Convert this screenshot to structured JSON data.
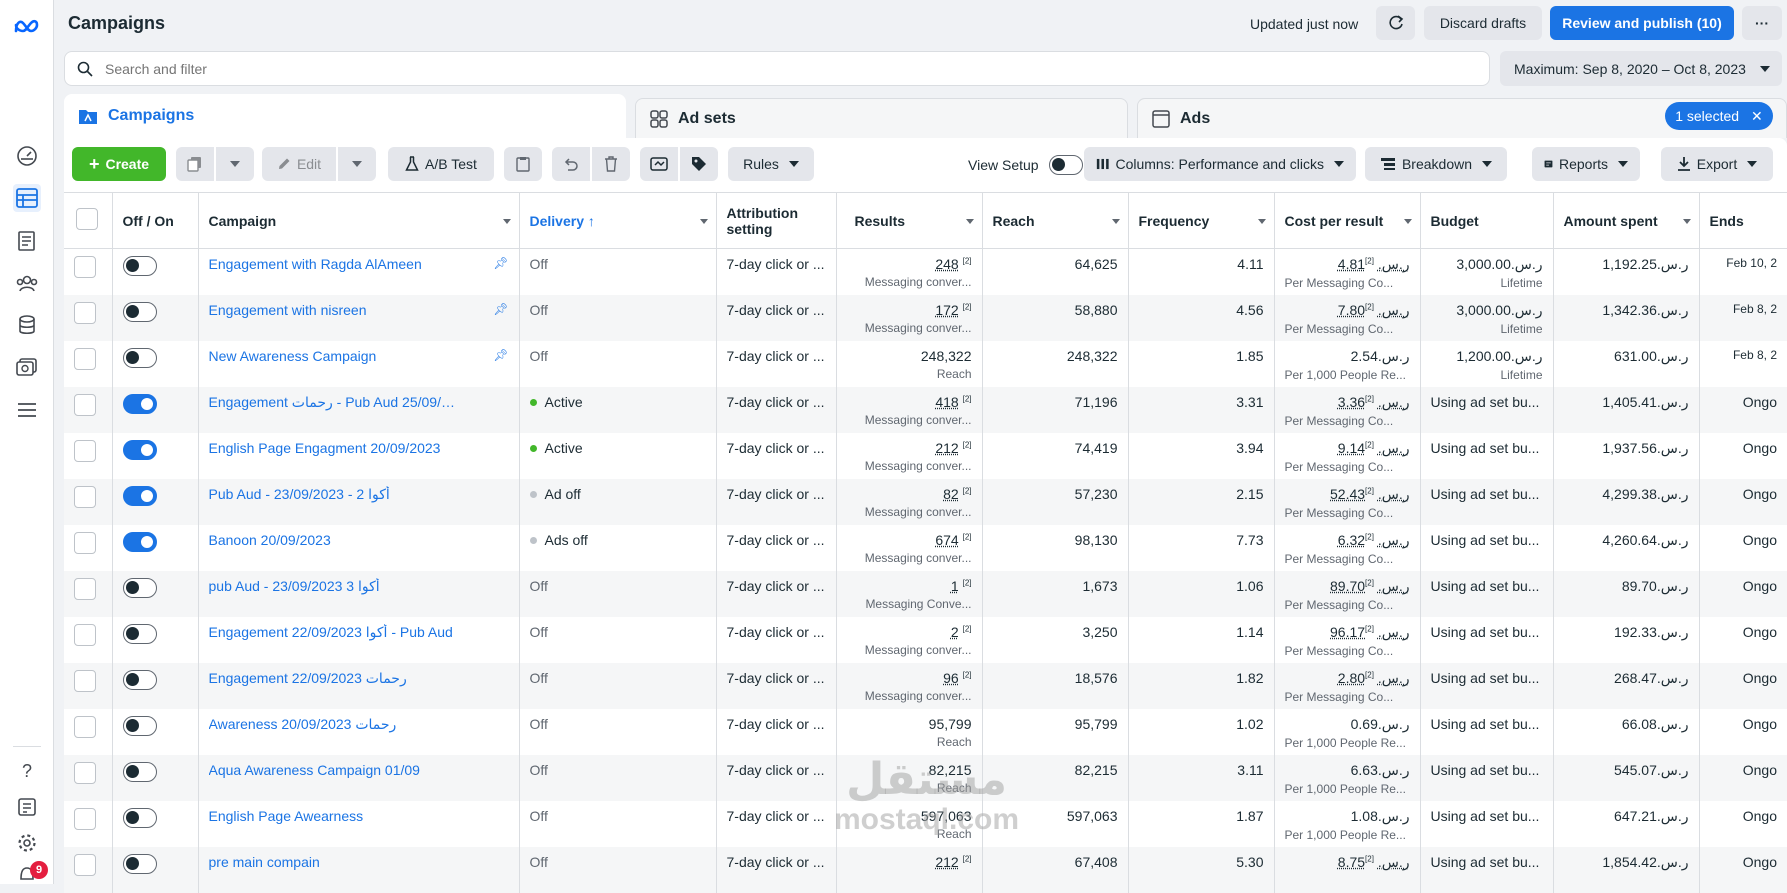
{
  "header": {
    "title": "Campaigns",
    "updated": "Updated just now",
    "discard": "Discard drafts",
    "review": "Review and publish (10)",
    "more": "···"
  },
  "search": {
    "placeholder": "Search and filter"
  },
  "date_range": "Maximum: Sep 8, 2020 – Oct 8, 2023",
  "tabs": [
    {
      "label": "Campaigns"
    },
    {
      "label": "Ad sets"
    },
    {
      "label": "Ads"
    }
  ],
  "selected_chip": "1 selected",
  "toolbar": {
    "create": "Create",
    "edit": "Edit",
    "ab_test": "A/B Test",
    "rules": "Rules",
    "view_setup": "View Setup",
    "columns": "Columns: Performance and clicks",
    "breakdown": "Breakdown",
    "reports": "Reports",
    "export": "Export"
  },
  "columns": [
    "Off / On",
    "Campaign",
    "Delivery ↑",
    "Attribution setting",
    "Results",
    "Reach",
    "Frequency",
    "Cost per result",
    "Budget",
    "Amount spent",
    "Ends"
  ],
  "rows": [
    {
      "on": false,
      "name": "Engagement with Ragda AlAmeen",
      "pinned": true,
      "delivery": "Off",
      "dot": "",
      "attr": "7-day click or ...",
      "results": "248",
      "results_sup": "[2]",
      "results_sub": "Messaging conver...",
      "reach": "64,625",
      "freq": "4.11",
      "cost": "4.81ر.س.‏",
      "cost_sup": "[2]",
      "cost_sub": "Per Messaging Co...",
      "budget": "3,000.00ر.س.‏",
      "budget_sub": "Lifetime",
      "spent": "1,192.25ر.س.‏",
      "ends": "Feb 10, 2"
    },
    {
      "on": false,
      "name": "Engagement with nisreen",
      "pinned": true,
      "delivery": "Off",
      "dot": "",
      "attr": "7-day click or ...",
      "results": "172",
      "results_sup": "[2]",
      "results_sub": "Messaging conver...",
      "reach": "58,880",
      "freq": "4.56",
      "cost": "7.80ر.س.‏",
      "cost_sup": "[2]",
      "cost_sub": "Per Messaging Co...",
      "budget": "3,000.00ر.س.‏",
      "budget_sub": "Lifetime",
      "spent": "1,342.36ر.س.‏",
      "ends": "Feb 8, 2"
    },
    {
      "on": false,
      "name": "New Awareness Campaign",
      "pinned": true,
      "delivery": "Off",
      "dot": "",
      "attr": "7-day click or ...",
      "results": "248,322",
      "results_sup": "",
      "results_sub": "Reach",
      "reach": "248,322",
      "freq": "1.85",
      "cost": "2.54ر.س.‏",
      "cost_sup": "",
      "cost_sub": "Per 1,000 People Re...",
      "budget": "1,200.00ر.س.‏",
      "budget_sub": "Lifetime",
      "spent": "631.00ر.س.‏",
      "ends": "Feb 8, 2"
    },
    {
      "on": true,
      "name": "Engagement رحمات - Pub Aud 25/09/2023",
      "pinned": false,
      "delivery": "Active",
      "dot": "#42b72a",
      "attr": "7-day click or ...",
      "results": "418",
      "results_sup": "[2]",
      "results_sub": "Messaging conver...",
      "reach": "71,196",
      "freq": "3.31",
      "cost": "3.36ر.س.‏",
      "cost_sup": "[2]",
      "cost_sub": "Per Messaging Co...",
      "budget": "Using ad set bu...",
      "budget_sub": "",
      "spent": "1,405.41ر.س.‏",
      "ends": "Ongo"
    },
    {
      "on": true,
      "name": "English Page Engagment 20/09/2023",
      "pinned": false,
      "delivery": "Active",
      "dot": "#42b72a",
      "attr": "7-day click or ...",
      "results": "212",
      "results_sup": "[2]",
      "results_sub": "Messaging conver...",
      "reach": "74,419",
      "freq": "3.94",
      "cost": "9.14ر.س.‏",
      "cost_sup": "[2]",
      "cost_sub": "Per Messaging Co...",
      "budget": "Using ad set bu...",
      "budget_sub": "",
      "spent": "1,937.56ر.س.‏",
      "ends": "Ongo"
    },
    {
      "on": true,
      "name": "Pub Aud - 23/09/2023 - 2 أكوا",
      "pinned": false,
      "delivery": "Ad off",
      "dot": "#bec3c9",
      "attr": "7-day click or ...",
      "results": "82",
      "results_sup": "[2]",
      "results_sub": "Messaging conver...",
      "reach": "57,230",
      "freq": "2.15",
      "cost": "52.43ر.س.‏",
      "cost_sup": "[2]",
      "cost_sub": "Per Messaging Co...",
      "budget": "Using ad set bu...",
      "budget_sub": "",
      "spent": "4,299.38ر.س.‏",
      "ends": "Ongo"
    },
    {
      "on": true,
      "name": "Banoon 20/09/2023",
      "pinned": false,
      "delivery": "Ads off",
      "dot": "#bec3c9",
      "attr": "7-day click or ...",
      "results": "674",
      "results_sup": "[2]",
      "results_sub": "Messaging conver...",
      "reach": "98,130",
      "freq": "7.73",
      "cost": "6.32ر.س.‏",
      "cost_sup": "[2]",
      "cost_sub": "Per Messaging Co...",
      "budget": "Using ad set bu...",
      "budget_sub": "",
      "spent": "4,260.64ر.س.‏",
      "ends": "Ongo"
    },
    {
      "on": false,
      "name": "pub Aud - 23/09/2023 3 أكوا",
      "pinned": false,
      "delivery": "Off",
      "dot": "",
      "attr": "7-day click or ...",
      "results": "1",
      "results_sup": "[2]",
      "results_sub": "Messaging Conve...",
      "reach": "1,673",
      "freq": "1.06",
      "cost": "89.70ر.س.‏",
      "cost_sup": "[2]",
      "cost_sub": "Per Messaging Co...",
      "budget": "Using ad set bu...",
      "budget_sub": "",
      "spent": "89.70ر.س.‏",
      "ends": "Ongo"
    },
    {
      "on": false,
      "name": "Engagement 22/09/2023 أكوا - Pub Aud",
      "pinned": false,
      "delivery": "Off",
      "dot": "",
      "attr": "7-day click or ...",
      "results": "2",
      "results_sup": "[2]",
      "results_sub": "Messaging conver...",
      "reach": "3,250",
      "freq": "1.14",
      "cost": "96.17ر.س.‏",
      "cost_sup": "[2]",
      "cost_sub": "Per Messaging Co...",
      "budget": "Using ad set bu...",
      "budget_sub": "",
      "spent": "192.33ر.س.‏",
      "ends": "Ongo"
    },
    {
      "on": false,
      "name": "Engagement 22/09/2023 رحمات",
      "pinned": false,
      "delivery": "Off",
      "dot": "",
      "attr": "7-day click or ...",
      "results": "96",
      "results_sup": "[2]",
      "results_sub": "Messaging conver...",
      "reach": "18,576",
      "freq": "1.82",
      "cost": "2.80ر.س.‏",
      "cost_sup": "[2]",
      "cost_sub": "Per Messaging Co...",
      "budget": "Using ad set bu...",
      "budget_sub": "",
      "spent": "268.47ر.س.‏",
      "ends": "Ongo"
    },
    {
      "on": false,
      "name": "Awareness 20/09/2023 رحمات",
      "pinned": false,
      "delivery": "Off",
      "dot": "",
      "attr": "7-day click or ...",
      "results": "95,799",
      "results_sup": "",
      "results_sub": "Reach",
      "reach": "95,799",
      "freq": "1.02",
      "cost": "0.69ر.س.‏",
      "cost_sup": "",
      "cost_sub": "Per 1,000 People Re...",
      "budget": "Using ad set bu...",
      "budget_sub": "",
      "spent": "66.08ر.س.‏",
      "ends": "Ongo"
    },
    {
      "on": false,
      "name": "Aqua Awareness Campaign 01/09",
      "pinned": false,
      "delivery": "Off",
      "dot": "",
      "attr": "7-day click or ...",
      "results": "82,215",
      "results_sup": "",
      "results_sub": "Reach",
      "reach": "82,215",
      "freq": "3.11",
      "cost": "6.63ر.س.‏",
      "cost_sup": "",
      "cost_sub": "Per 1,000 People Re...",
      "budget": "Using ad set bu...",
      "budget_sub": "",
      "spent": "545.07ر.س.‏",
      "ends": "Ongo"
    },
    {
      "on": false,
      "name": "English Page Awearness",
      "pinned": false,
      "delivery": "Off",
      "dot": "",
      "attr": "7-day click or ...",
      "results": "597,063",
      "results_sup": "",
      "results_sub": "Reach",
      "reach": "597,063",
      "freq": "1.87",
      "cost": "1.08ر.س.‏",
      "cost_sup": "",
      "cost_sub": "Per 1,000 People Re...",
      "budget": "Using ad set bu...",
      "budget_sub": "",
      "spent": "647.21ر.س.‏",
      "ends": "Ongo"
    },
    {
      "on": false,
      "name": "pre main compain",
      "pinned": false,
      "delivery": "Off",
      "dot": "",
      "attr": "7-day click or ...",
      "results": "212",
      "results_sup": "[2]",
      "results_sub": "",
      "reach": "67,408",
      "freq": "5.30",
      "cost": "8.75ر.س.‏",
      "cost_sup": "[2]",
      "cost_sub": "",
      "budget": "Using ad set bu...",
      "budget_sub": "",
      "spent": "1,854.42ر.س.‏",
      "ends": "Ongo"
    }
  ],
  "nav_badge": "9",
  "watermark": {
    "arabic": "مستقل",
    "latin": "mostaql.com"
  }
}
